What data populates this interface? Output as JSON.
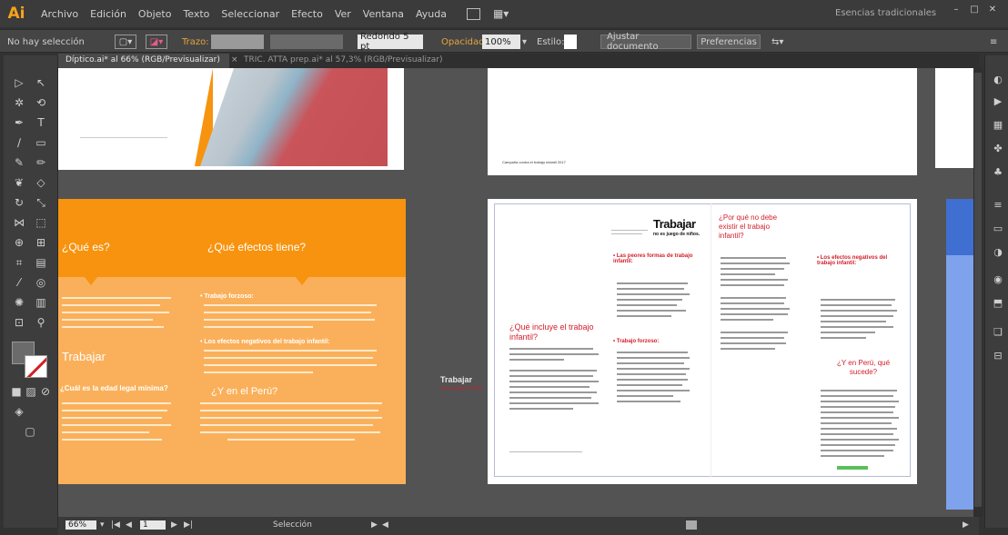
{
  "menubar": {
    "logo": "Ai",
    "items": [
      "Archivo",
      "Edición",
      "Objeto",
      "Texto",
      "Seleccionar",
      "Efecto",
      "Ver",
      "Ventana",
      "Ayuda"
    ],
    "workspace": "Esencias tradicionales",
    "window_controls": [
      "minimize-icon",
      "maximize-icon",
      "close-icon"
    ]
  },
  "control_bar": {
    "selection": "No hay selección",
    "stroke_label": "Trazo:",
    "brush": "Redondo 5 pt",
    "opacity_label": "Opacidad:",
    "opacity_value": "100%",
    "style_label": "Estilo:",
    "document_setup": "Ajustar documento",
    "preferences": "Preferencias"
  },
  "tabs": [
    {
      "label": "Díptico.ai* al 66% (RGB/Previsualizar)",
      "active": true
    },
    {
      "label": "TRIC. ATTA prep.ai* al 57,3% (RGB/Previsualizar)",
      "active": false
    }
  ],
  "canvas": {
    "orange_panel": {
      "heading_left": "¿Qué es?",
      "heading_right": "¿Qué efectos tiene?",
      "bullet1": "• Trabajo forzoso:",
      "bullet2": "• Los efectos negativos del trabajo infantil:",
      "left_heading_lower": "¿Cuál es la edad legal mínima?",
      "right_heading_lower": "¿Y en el Perú?"
    },
    "brochure": {
      "logo_big": "Trabajar",
      "logo_sub": "no es juego de niños.",
      "small_logo": "Trabajar",
      "small_logo_sub": "no es juego de niños.",
      "q1": "¿Qué incluye el trabajo infantil?",
      "q2": "¿Por qué no debe existir el trabajo infantil?",
      "q3": "¿Y en Perú, qué sucede?",
      "b_forms": "• Las peores formas de trabajo infantil:",
      "b_forced": "• Trabajo forzoso:",
      "b_effects": "• Los efectos negativos del trabajo infantil:",
      "top_caption": "Campaña contra el trabajo infantil 2017"
    }
  },
  "status_bar": {
    "zoom": "66%",
    "page": "1",
    "tool": "Selección"
  },
  "colors": {
    "orange_header": "#f7930f",
    "orange_body": "#fab05a",
    "accent_red": "#d21f2c",
    "blue_strip": "#3f6fd0"
  }
}
